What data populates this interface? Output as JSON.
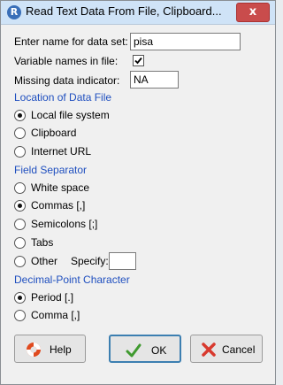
{
  "window": {
    "title": "Read Text Data From File, Clipboard...",
    "app_icon_letter": "R",
    "close_label": "x"
  },
  "form": {
    "dataset_label": "Enter name for data set:",
    "dataset_value": "pisa",
    "varnames_label": "Variable names in file:",
    "varnames_checked": true,
    "missing_label": "Missing data indicator:",
    "missing_value": "NA"
  },
  "location": {
    "title": "Location of Data File",
    "options": [
      "Local file system",
      "Clipboard",
      "Internet URL"
    ],
    "selected": 0
  },
  "separator": {
    "title": "Field Separator",
    "options": [
      "White space",
      "Commas [,]",
      "Semicolons [;]",
      "Tabs",
      "Other"
    ],
    "selected": 1,
    "specify_label": "Specify:",
    "specify_value": ""
  },
  "decimal": {
    "title": "Decimal-Point Character",
    "options": [
      "Period [.]",
      "Comma [,]"
    ],
    "selected": 0
  },
  "buttons": {
    "help_label": "Help",
    "ok_label": "OK",
    "cancel_label": "Cancel"
  },
  "colors": {
    "section_title": "#1f4fbf",
    "ok_icon": "#3f9a2f",
    "cancel_icon": "#d8392e",
    "help_icon": "#e04a1f"
  }
}
